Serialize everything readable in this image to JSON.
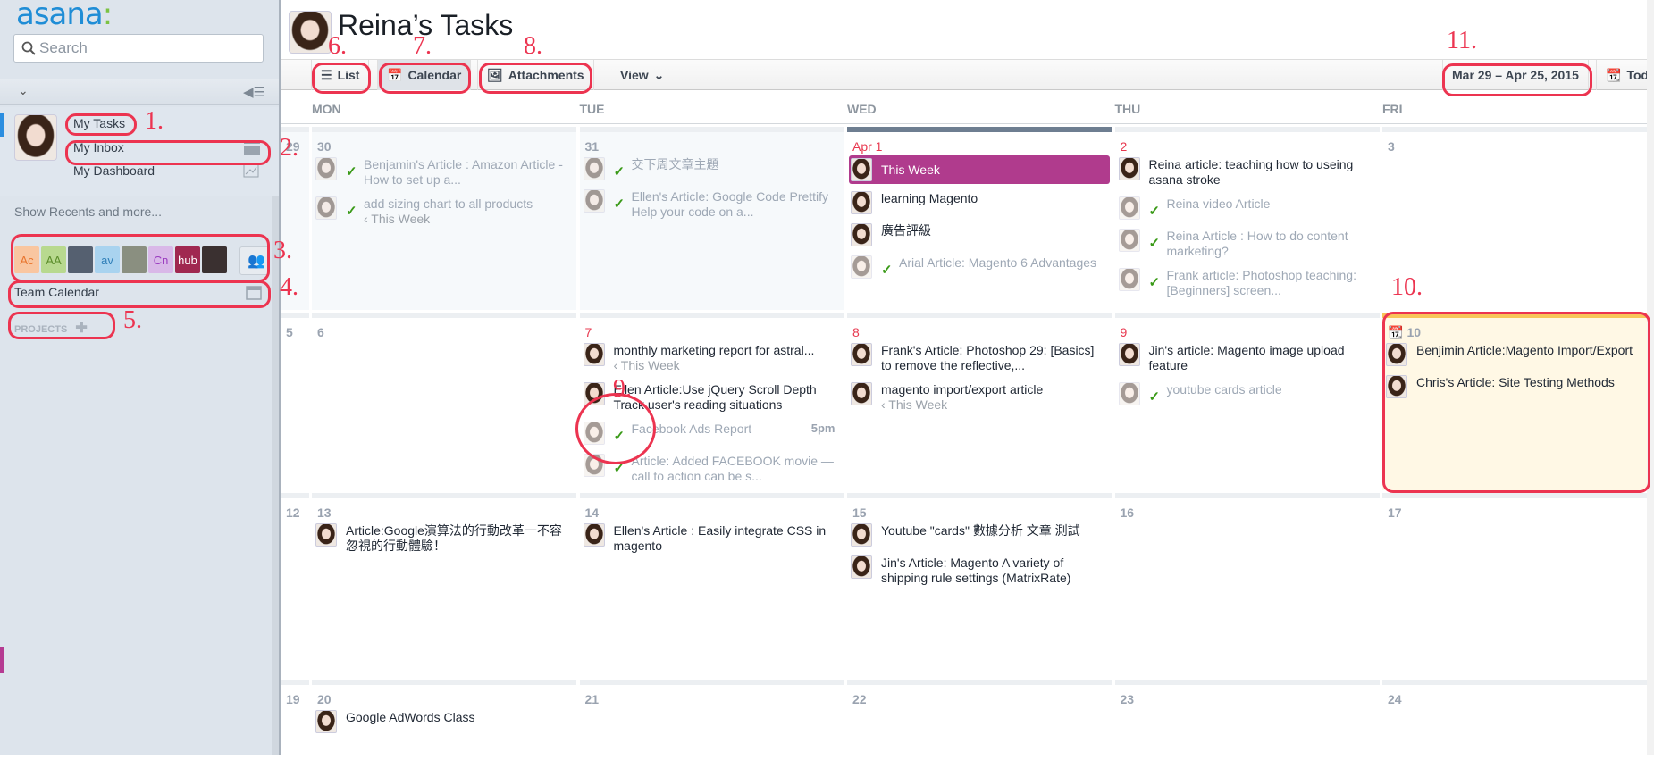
{
  "sidebar": {
    "logo": "asana",
    "search_placeholder": "Search",
    "items": [
      {
        "label": "My Tasks"
      },
      {
        "label": "My Inbox"
      },
      {
        "label": "My Dashboard"
      }
    ],
    "recents_link": "Show Recents and more...",
    "team_members": [
      {
        "initials": "Ac",
        "bg": "#f9c6a0",
        "fg": "#e8742c"
      },
      {
        "initials": "AA",
        "bg": "#b8d98f",
        "fg": "#5a8c2a"
      },
      {
        "initials": "",
        "bg": "#556070",
        "fg": "#fff"
      },
      {
        "initials": "av",
        "bg": "#a9d3ef",
        "fg": "#2f7fb8"
      },
      {
        "initials": "",
        "bg": "#8a8f80",
        "fg": "#fff"
      },
      {
        "initials": "Cn",
        "bg": "#d9b8e8",
        "fg": "#9a3cc0"
      },
      {
        "initials": "hub",
        "bg": "#a02850",
        "fg": "#fff"
      },
      {
        "initials": "",
        "bg": "#3a3030",
        "fg": "#fff"
      }
    ],
    "team_calendar": "Team Calendar",
    "projects_label": "PROJECTS"
  },
  "header": {
    "title": "Reina’s Tasks"
  },
  "toolbar": {
    "list": "List",
    "calendar": "Calendar",
    "attachments": "Attachments",
    "view": "View",
    "date_range": "Mar 29 – Apr 25, 2015",
    "today": "Today"
  },
  "weekdays": [
    "MON",
    "TUE",
    "WED",
    "THU",
    "FRI"
  ],
  "weeks": [
    {
      "week_label": "29",
      "days": [
        {
          "label": "30",
          "style": "past",
          "tasks": [
            {
              "title": "Benjamin's Article : Amazon Article - How to set up a...",
              "done": true
            },
            {
              "title": "add sizing chart to all products",
              "sub": "‹ This Week",
              "done": true
            }
          ]
        },
        {
          "label": "31",
          "style": "past",
          "tasks": [
            {
              "title": "交下周文章主題",
              "done": true
            },
            {
              "title": "Ellen's Article: Google Code Prettify Help your code on a...",
              "done": true
            }
          ]
        },
        {
          "label": "Apr 1",
          "style": "today",
          "red": true,
          "tasks": [
            {
              "title": "This Week",
              "purple": true
            },
            {
              "title": "learning Magento"
            },
            {
              "title": "廣告評級"
            },
            {
              "title": "Arial Article: Magento 6 Advantages",
              "done": true
            }
          ]
        },
        {
          "label": "2",
          "red": true,
          "tasks": [
            {
              "title": "Reina article: teaching how to useing asana stroke"
            },
            {
              "title": "Reina video Article",
              "done": true
            },
            {
              "title": "Reina Article : How to do content marketing?",
              "done": true
            },
            {
              "title": "Frank article: Photoshop teaching: [Beginners] screen...",
              "done": true
            }
          ]
        },
        {
          "label": "3",
          "tasks": []
        }
      ]
    },
    {
      "week_label": "5",
      "days": [
        {
          "label": "6",
          "tasks": []
        },
        {
          "label": "7",
          "red": true,
          "tasks": [
            {
              "title": "monthly marketing report for astral...",
              "sub": "‹ This Week"
            },
            {
              "title": "Ellen Article:Use jQuery Scroll Depth Track user's reading situations"
            },
            {
              "title": "Facebook Ads Report",
              "done": true,
              "time": "5pm"
            },
            {
              "title": "Article: Added FACEBOOK movie — call to action can be s...",
              "done": true
            }
          ]
        },
        {
          "label": "8",
          "red": true,
          "tasks": [
            {
              "title": "Frank's Article: Photoshop 29: [Basics] to remove the reflective,..."
            },
            {
              "title": "magento import/export article",
              "sub": "‹ This Week"
            }
          ]
        },
        {
          "label": "9",
          "red": true,
          "tasks": [
            {
              "title": "Jin's article: Magento image upload feature"
            },
            {
              "title": "youtube cards article",
              "done": true
            }
          ]
        },
        {
          "label": "10",
          "style": "hl",
          "star": true,
          "tasks": [
            {
              "title": "Benjimin Article:Magento Import/Export"
            },
            {
              "title": "Chris's Article: Site Testing Methods"
            }
          ]
        }
      ]
    },
    {
      "week_label": "12",
      "days": [
        {
          "label": "13",
          "tasks": [
            {
              "title": "Article:Google演算法的行動改革一不容忽視的行動體驗！"
            }
          ]
        },
        {
          "label": "14",
          "tasks": [
            {
              "title": "Ellen's Article : Easily integrate CSS in magento"
            }
          ]
        },
        {
          "label": "15",
          "tasks": [
            {
              "title": "Youtube \"cards\" 數據分析  文章 測試"
            },
            {
              "title": "Jin's Article: Magento A variety of shipping rule settings (MatrixRate)"
            }
          ]
        },
        {
          "label": "16",
          "tasks": []
        },
        {
          "label": "17",
          "tasks": []
        }
      ]
    },
    {
      "week_label": "19",
      "days": [
        {
          "label": "20",
          "tasks": [
            {
              "title": "Google AdWords Class"
            }
          ]
        },
        {
          "label": "21",
          "tasks": []
        },
        {
          "label": "22",
          "tasks": []
        },
        {
          "label": "23",
          "tasks": []
        },
        {
          "label": "24",
          "tasks": []
        }
      ]
    }
  ],
  "annotations": [
    "1.",
    "2.",
    "3.",
    "4.",
    "5.",
    "6.",
    "7.",
    "8.",
    "9.",
    "10.",
    "11."
  ],
  "colors": {
    "accent": "#1f8dd6",
    "today_task": "#b03b8d",
    "check": "#3a9a18",
    "date_red": "#e8384f",
    "highlight": "#fff8e5"
  }
}
